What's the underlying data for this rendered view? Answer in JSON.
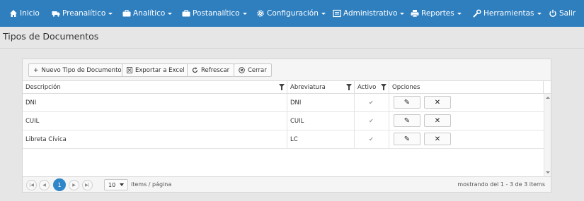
{
  "nav": {
    "items": [
      {
        "label": "Inicio",
        "icon": "home-icon",
        "caret": false
      },
      {
        "label": "Preanalítico",
        "icon": "truck-icon",
        "caret": true
      },
      {
        "label": "Analítico",
        "icon": "briefcase-icon",
        "caret": true
      },
      {
        "label": "Postanalítico",
        "icon": "briefcase-icon",
        "caret": true
      },
      {
        "label": "Configuración",
        "icon": "gear-icon",
        "caret": true
      },
      {
        "label": "Administrativo",
        "icon": "list-icon",
        "caret": true
      },
      {
        "label": "Reportes",
        "icon": "print-icon",
        "caret": true
      },
      {
        "label": "Herramientas",
        "icon": "wrench-icon",
        "caret": true
      },
      {
        "label": "Salir",
        "icon": "power-icon",
        "caret": false
      }
    ]
  },
  "page": {
    "title": "Tipos de Documentos"
  },
  "toolbar": {
    "new_label": "Nuevo Tipo de Documento",
    "export_label": "Exportar a Excel",
    "refresh_label": "Refrescar",
    "close_label": "Cerrar"
  },
  "table": {
    "columns": [
      "Descripción",
      "Abreviatura",
      "Activo",
      "Opciones"
    ],
    "rows": [
      {
        "descripcion": "DNI",
        "abreviatura": "DNI",
        "activo": true
      },
      {
        "descripcion": "CUIL",
        "abreviatura": "CUIL",
        "activo": true
      },
      {
        "descripcion": "Libreta Cívica",
        "abreviatura": "LC",
        "activo": true
      }
    ]
  },
  "pager": {
    "current_page": "1",
    "page_size": "10",
    "page_size_label": "items / página",
    "info": "mostrando del 1 - 3 de 3 items"
  },
  "colors": {
    "navbar": "#2f7fbf",
    "accent": "#2f86c8"
  }
}
